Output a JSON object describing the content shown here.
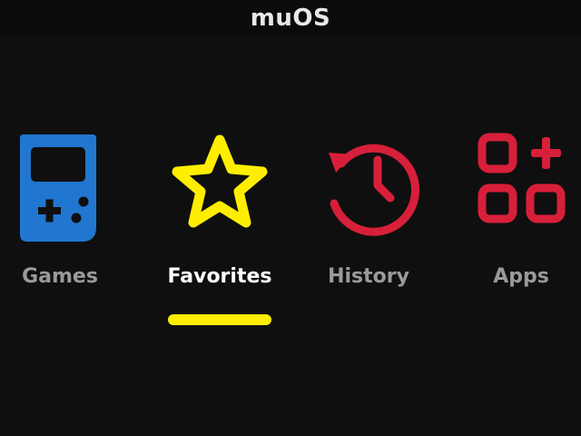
{
  "header": {
    "title": "muOS"
  },
  "menu": {
    "selected_index": 1,
    "items": [
      {
        "label": "Games",
        "icon": "gameboy-icon",
        "color": "#2176cf"
      },
      {
        "label": "Favorites",
        "icon": "star-icon",
        "color": "#ffee00"
      },
      {
        "label": "History",
        "icon": "history-icon",
        "color": "#d81f3a"
      },
      {
        "label": "Apps",
        "icon": "apps-grid-icon",
        "color": "#d81f3a"
      }
    ]
  },
  "colors": {
    "background": "#0f0f0f",
    "header_background": "#0b0b0b",
    "label_inactive": "#9a9a9a",
    "label_active": "#ffffff",
    "highlight": "#ffee00"
  }
}
